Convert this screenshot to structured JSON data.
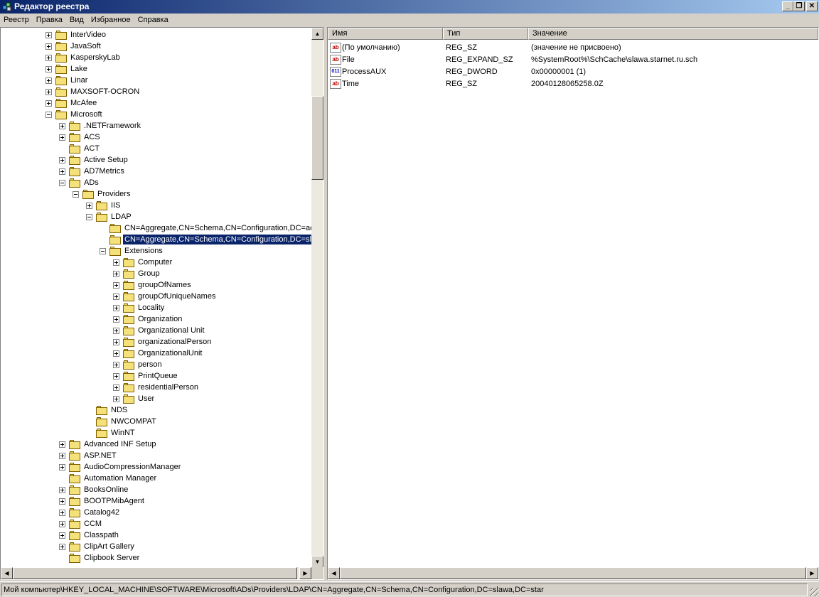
{
  "window": {
    "title": "Редактор реестра"
  },
  "menu": [
    "Реестр",
    "Правка",
    "Вид",
    "Избранное",
    "Справка"
  ],
  "tree": [
    {
      "label": "InterVideo",
      "depth": 0,
      "expander": "plus"
    },
    {
      "label": "JavaSoft",
      "depth": 0,
      "expander": "plus"
    },
    {
      "label": "KasperskyLab",
      "depth": 0,
      "expander": "plus"
    },
    {
      "label": "Lake",
      "depth": 0,
      "expander": "plus"
    },
    {
      "label": "Linar",
      "depth": 0,
      "expander": "plus"
    },
    {
      "label": "MAXSOFT-OCRON",
      "depth": 0,
      "expander": "plus"
    },
    {
      "label": "McAfee",
      "depth": 0,
      "expander": "plus"
    },
    {
      "label": "Microsoft",
      "depth": 0,
      "expander": "minus"
    },
    {
      "label": ".NETFramework",
      "depth": 1,
      "expander": "plus"
    },
    {
      "label": "ACS",
      "depth": 1,
      "expander": "plus"
    },
    {
      "label": "ACT",
      "depth": 1,
      "expander": "none"
    },
    {
      "label": "Active Setup",
      "depth": 1,
      "expander": "plus"
    },
    {
      "label": "AD7Metrics",
      "depth": 1,
      "expander": "plus"
    },
    {
      "label": "ADs",
      "depth": 1,
      "expander": "minus"
    },
    {
      "label": "Providers",
      "depth": 2,
      "expander": "minus"
    },
    {
      "label": "IIS",
      "depth": 3,
      "expander": "plus"
    },
    {
      "label": "LDAP",
      "depth": 3,
      "expander": "minus"
    },
    {
      "label": "CN=Aggregate,CN=Schema,CN=Configuration,DC=ac",
      "depth": 4,
      "expander": "none"
    },
    {
      "label": "CN=Aggregate,CN=Schema,CN=Configuration,DC=sl",
      "depth": 4,
      "expander": "none",
      "selected": true
    },
    {
      "label": "Extensions",
      "depth": 4,
      "expander": "minus"
    },
    {
      "label": "Computer",
      "depth": 5,
      "expander": "plus"
    },
    {
      "label": "Group",
      "depth": 5,
      "expander": "plus"
    },
    {
      "label": "groupOfNames",
      "depth": 5,
      "expander": "plus"
    },
    {
      "label": "groupOfUniqueNames",
      "depth": 5,
      "expander": "plus"
    },
    {
      "label": "Locality",
      "depth": 5,
      "expander": "plus"
    },
    {
      "label": "Organization",
      "depth": 5,
      "expander": "plus"
    },
    {
      "label": "Organizational Unit",
      "depth": 5,
      "expander": "plus"
    },
    {
      "label": "organizationalPerson",
      "depth": 5,
      "expander": "plus"
    },
    {
      "label": "OrganizationalUnit",
      "depth": 5,
      "expander": "plus"
    },
    {
      "label": "person",
      "depth": 5,
      "expander": "plus"
    },
    {
      "label": "PrintQueue",
      "depth": 5,
      "expander": "plus"
    },
    {
      "label": "residentialPerson",
      "depth": 5,
      "expander": "plus"
    },
    {
      "label": "User",
      "depth": 5,
      "expander": "plus"
    },
    {
      "label": "NDS",
      "depth": 3,
      "expander": "none"
    },
    {
      "label": "NWCOMPAT",
      "depth": 3,
      "expander": "none"
    },
    {
      "label": "WinNT",
      "depth": 3,
      "expander": "none"
    },
    {
      "label": "Advanced INF Setup",
      "depth": 1,
      "expander": "plus"
    },
    {
      "label": "ASP.NET",
      "depth": 1,
      "expander": "plus"
    },
    {
      "label": "AudioCompressionManager",
      "depth": 1,
      "expander": "plus"
    },
    {
      "label": "Automation Manager",
      "depth": 1,
      "expander": "none"
    },
    {
      "label": "BooksOnline",
      "depth": 1,
      "expander": "plus"
    },
    {
      "label": "BOOTPMibAgent",
      "depth": 1,
      "expander": "plus"
    },
    {
      "label": "Catalog42",
      "depth": 1,
      "expander": "plus"
    },
    {
      "label": "CCM",
      "depth": 1,
      "expander": "plus"
    },
    {
      "label": "Classpath",
      "depth": 1,
      "expander": "plus"
    },
    {
      "label": "ClipArt Gallery",
      "depth": 1,
      "expander": "plus"
    },
    {
      "label": "Clipbook Server",
      "depth": 1,
      "expander": "none"
    }
  ],
  "list": {
    "columns": [
      "Имя",
      "Тип",
      "Значение"
    ],
    "rows": [
      {
        "icon": "string-value-icon",
        "name": "(По умолчанию)",
        "type": "REG_SZ",
        "value": "(значение не присвоено)"
      },
      {
        "icon": "string-value-icon",
        "name": "File",
        "type": "REG_EXPAND_SZ",
        "value": "%SystemRoot%\\SchCache\\slawa.starnet.ru.sch"
      },
      {
        "icon": "binary-value-icon",
        "name": "ProcessAUX",
        "type": "REG_DWORD",
        "value": "0x00000001 (1)"
      },
      {
        "icon": "string-value-icon",
        "name": "Time",
        "type": "REG_SZ",
        "value": "20040128065258.0Z"
      }
    ]
  },
  "status": "Мой компьютер\\HKEY_LOCAL_MACHINE\\SOFTWARE\\Microsoft\\ADs\\Providers\\LDAP\\CN=Aggregate,CN=Schema,CN=Configuration,DC=slawa,DC=star"
}
